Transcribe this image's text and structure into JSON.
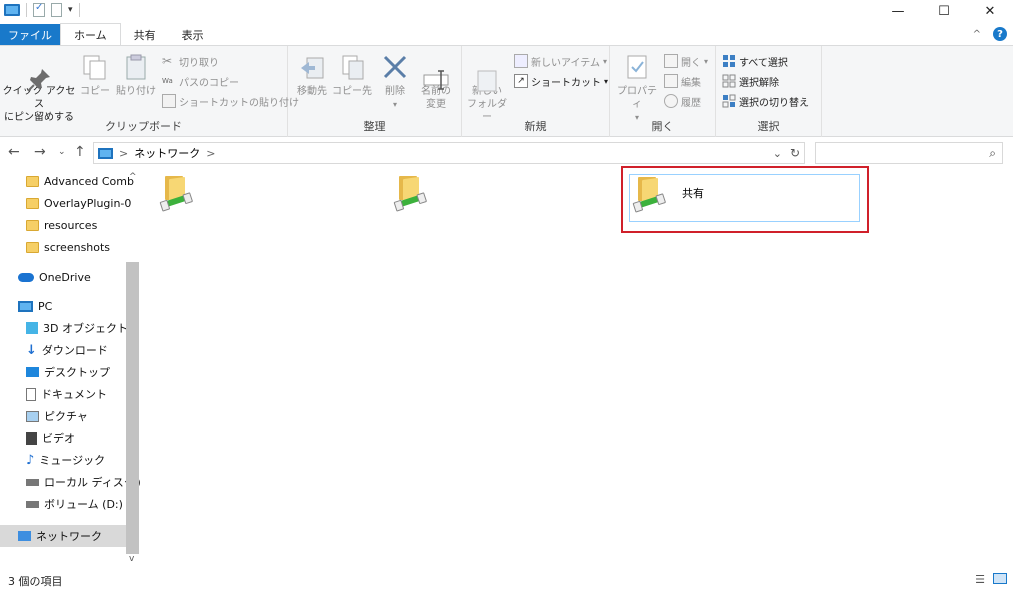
{
  "window": {
    "close": "✕",
    "maximize": "☐",
    "minimize": "—"
  },
  "tabs": [
    "ファイル",
    "ホーム",
    "共有",
    "表示"
  ],
  "ribbon": {
    "clipboard": {
      "label": "クリップボード",
      "pin": "クイック アクセス\nにピン留めする",
      "copy": "コピー",
      "paste": "貼り付け",
      "cut": "切り取り",
      "copy_path": "パスのコピー",
      "paste_shortcut": "ショートカットの貼り付け"
    },
    "organize": {
      "label": "整理",
      "move_to": "移動先",
      "copy_to": "コピー先",
      "delete": "削除",
      "rename": "名前の\n変更"
    },
    "new": {
      "label": "新規",
      "new_folder": "新しい\nフォルダー",
      "new_item": "新しいアイテム",
      "shortcut": "ショートカット"
    },
    "open": {
      "label": "開く",
      "properties": "プロパティ",
      "open": "開く",
      "edit": "編集",
      "history": "履歴"
    },
    "select": {
      "label": "選択",
      "select_all": "すべて選択",
      "select_none": "選択解除",
      "invert": "選択の切り替え"
    }
  },
  "address": {
    "path": "ネットワーク",
    "sep": ">",
    "search_placeholder": ""
  },
  "nav": {
    "folders": [
      "Advanced Comb",
      "OverlayPlugin-0",
      "resources",
      "screenshots"
    ],
    "onedrive": "OneDrive",
    "pc": "PC",
    "pc_items": [
      "3D オブジェクト",
      "ダウンロード",
      "デスクトップ",
      "ドキュメント",
      "ピクチャ",
      "ビデオ",
      "ミュージック",
      "ローカル ディスク (C",
      "ボリューム (D:)"
    ],
    "network": "ネットワーク"
  },
  "content": {
    "items": [
      {
        "label": ""
      },
      {
        "label": ""
      },
      {
        "label": "共有"
      }
    ]
  },
  "status": {
    "count": "3 個の項目"
  },
  "colors": {
    "file_tab": "#1979ca",
    "highlight_border": "#d0202a",
    "selection": "#99d1ff"
  }
}
